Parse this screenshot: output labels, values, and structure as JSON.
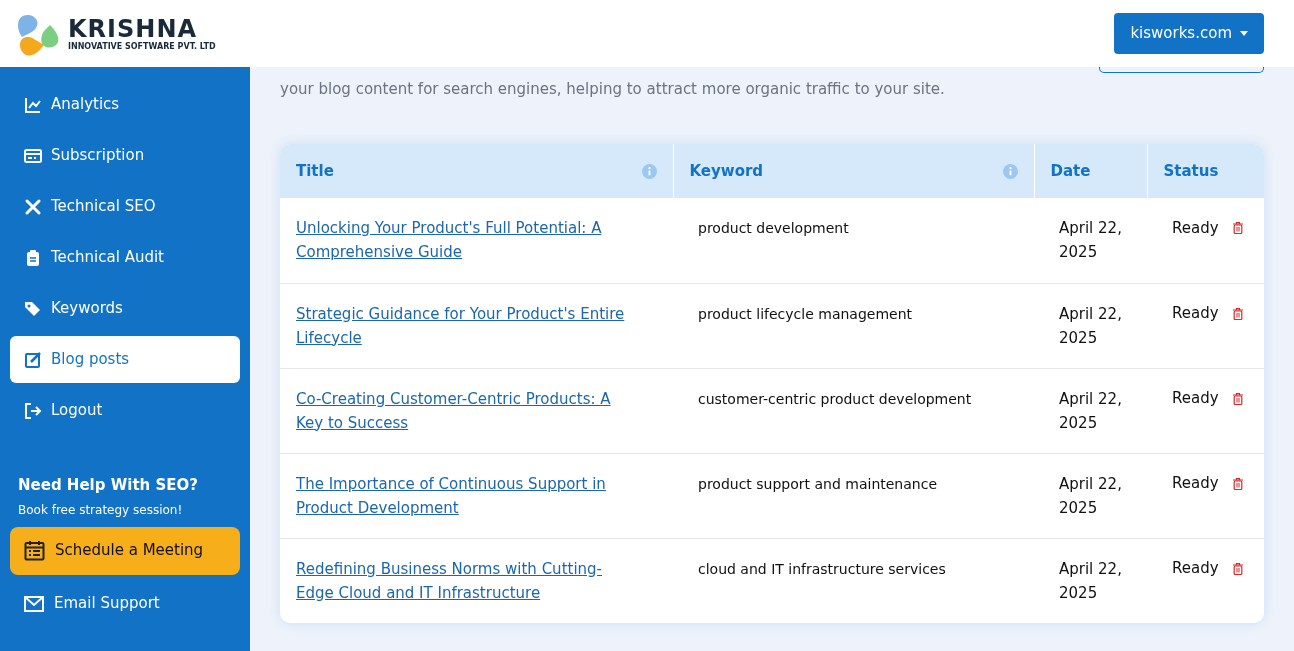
{
  "header": {
    "logo_title": "KRISHNA",
    "logo_subtitle": "INNOVATIVE SOFTWARE PVT. LTD",
    "site_menu": "kisworks.com"
  },
  "sidebar": {
    "items": [
      {
        "label": "Analytics",
        "selected": false
      },
      {
        "label": "Subscription",
        "selected": false
      },
      {
        "label": "Technical SEO",
        "selected": false
      },
      {
        "label": "Technical Audit",
        "selected": false
      },
      {
        "label": "Keywords",
        "selected": false
      },
      {
        "label": "Blog posts",
        "selected": true
      },
      {
        "label": "Logout",
        "selected": false
      }
    ],
    "help_title": "Need Help With SEO?",
    "help_subtitle": "Book free strategy session!",
    "schedule_button": "Schedule a Meeting",
    "email_link": "Email Support"
  },
  "intro": [
    "your blog content for search engines, helping to attract more organic traffic to your site."
  ],
  "table": {
    "columns": [
      {
        "label": "Title",
        "info": true
      },
      {
        "label": "Keyword",
        "info": true
      },
      {
        "label": "Date",
        "info": false
      },
      {
        "label": "Status",
        "info": false
      }
    ],
    "rows": [
      {
        "title": "Unlocking Your Product's Full Potential: A Comprehensive Guide",
        "keyword": "product development",
        "date": "April 22, 2025",
        "status": "Ready"
      },
      {
        "title": "Strategic Guidance for Your Product's Entire Lifecycle",
        "keyword": "product lifecycle management",
        "date": "April 22, 2025",
        "status": "Ready"
      },
      {
        "title": "Co-Creating Customer-Centric Products: A Key to Success",
        "keyword": "customer-centric product development",
        "date": "April 22, 2025",
        "status": "Ready"
      },
      {
        "title": "The Importance of Continuous Support in Product Development",
        "keyword": "product support and maintenance",
        "date": "April 22, 2025",
        "status": "Ready"
      },
      {
        "title": "Redefining Business Norms with Cutting-Edge Cloud and IT Infrastructure",
        "keyword": "cloud and IT infrastructure services",
        "date": "April 22, 2025",
        "status": "Ready"
      }
    ]
  }
}
